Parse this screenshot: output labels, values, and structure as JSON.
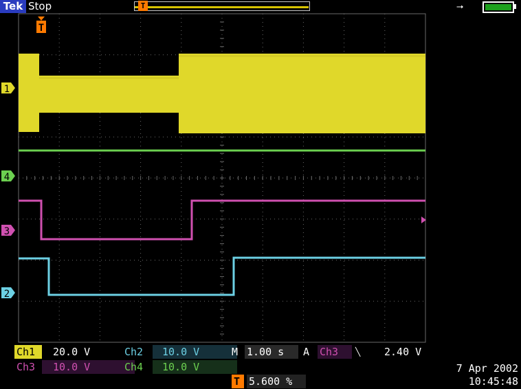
{
  "header": {
    "brand": "Tek",
    "state": "Stop"
  },
  "markers": {
    "trigger": "T",
    "ch1": "1",
    "ch4": "4",
    "ch3": "3",
    "ch2": "2"
  },
  "colors": {
    "ch1": "#e0d82a",
    "ch2": "#6cd0e4",
    "ch3": "#d050b0",
    "ch4": "#6cd050",
    "trigger": "#ff7a00",
    "grid": "#6a6a6a"
  },
  "icons": {
    "power": "ac-plug-icon",
    "battery": "battery-icon"
  },
  "readouts": {
    "ch1_label": "Ch1",
    "ch1_scale": "20.0 V",
    "ch2_label": "Ch2",
    "ch2_scale": "10.0 V",
    "ch3_label": "Ch3",
    "ch3_scale": "10.0 V",
    "ch4_label": "Ch4",
    "ch4_scale": "10.0 V",
    "m_label": "M",
    "timebase": "1.00 s",
    "a_label": "A",
    "trigger_source": "Ch3",
    "trigger_slope": "╲",
    "trigger_level": "2.40 V",
    "trigger_position": "5.600 %",
    "date": "7 Apr  2002",
    "time": "10:45:48"
  }
}
